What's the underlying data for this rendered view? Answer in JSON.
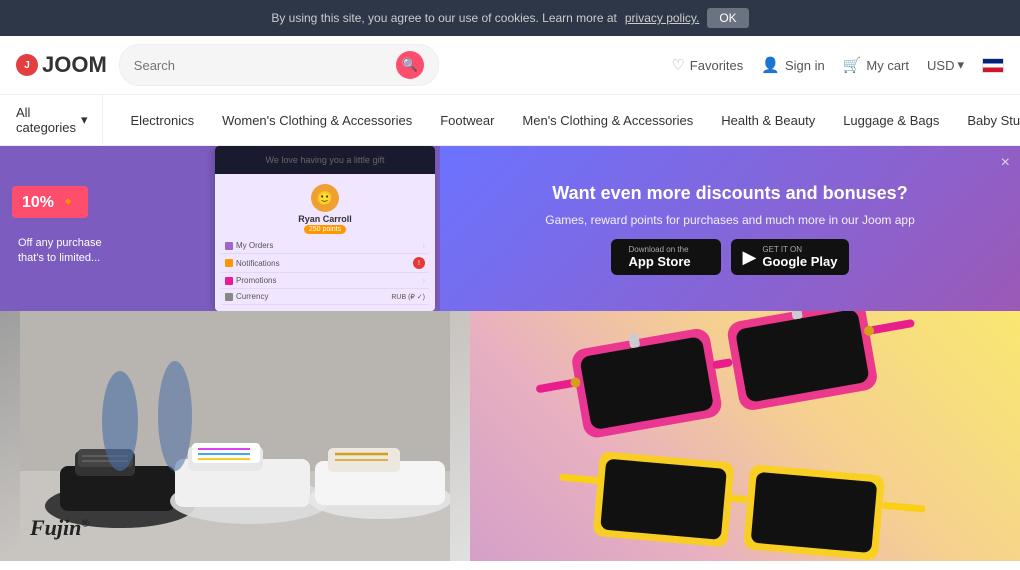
{
  "cookie_banner": {
    "text": "By using this site, you agree to our use of cookies. Learn more at",
    "link_text": "privacy policy.",
    "ok_label": "OK"
  },
  "header": {
    "logo_text": "JOOM",
    "search_placeholder": "Search",
    "favorites_label": "Favorites",
    "signin_label": "Sign in",
    "cart_label": "My cart",
    "currency": "USD",
    "currency_arrow": "▾"
  },
  "nav": {
    "all_categories": "All categories",
    "items": [
      {
        "label": "Electronics"
      },
      {
        "label": "Women's Clothing & Accessories"
      },
      {
        "label": "Footwear"
      },
      {
        "label": "Men's Clothing & Accessories"
      },
      {
        "label": "Health & Beauty"
      },
      {
        "label": "Luggage & Bags"
      },
      {
        "label": "Baby Stuff"
      }
    ]
  },
  "promo_left": {
    "discount": "10%",
    "off_text": "Off any purchase",
    "limit_text": "that's to limited..."
  },
  "phone_screen": {
    "user_name": "Ryan Carroll",
    "points": "250 points",
    "menu_items": [
      {
        "label": "My Orders",
        "icon": "purple"
      },
      {
        "label": "Notifications",
        "icon": "orange"
      },
      {
        "label": "Promotions",
        "icon": "pink"
      },
      {
        "label": "Currency",
        "icon": "gray",
        "value": "RUB (₽ ✓)"
      }
    ],
    "header_text": "We love having you a little gift"
  },
  "promo_right": {
    "title": "Want even more discounts\nand bonuses?",
    "subtitle": "Games, reward points for purchases and much more\nin our Joom app",
    "close_icon": "×",
    "app_store": {
      "small_text": "Download on the",
      "label": "App Store",
      "icon": "🍎"
    },
    "google_play": {
      "small_text": "GET IT ON",
      "label": "Google Play",
      "icon": "▶"
    }
  },
  "fujin_brand": {
    "name": "Fujin",
    "tm": "®"
  }
}
